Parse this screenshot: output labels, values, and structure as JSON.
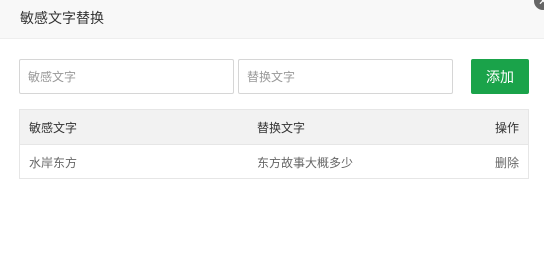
{
  "dialog": {
    "title": "敏感文字替换",
    "close_icon": "close-icon"
  },
  "form": {
    "sensitive_placeholder": "敏感文字",
    "replace_placeholder": "替换文字",
    "sensitive_value": "",
    "replace_value": "",
    "add_label": "添加"
  },
  "table": {
    "headers": [
      "敏感文字",
      "替换文字",
      "操作"
    ],
    "rows": [
      {
        "sensitive": "水岸东方",
        "replacement": "东方故事大概多少",
        "action": "删除"
      }
    ]
  },
  "colors": {
    "accent": "#1aa34a",
    "header_bg": "#f8f8f8",
    "table_head_bg": "#f2f2f2"
  }
}
